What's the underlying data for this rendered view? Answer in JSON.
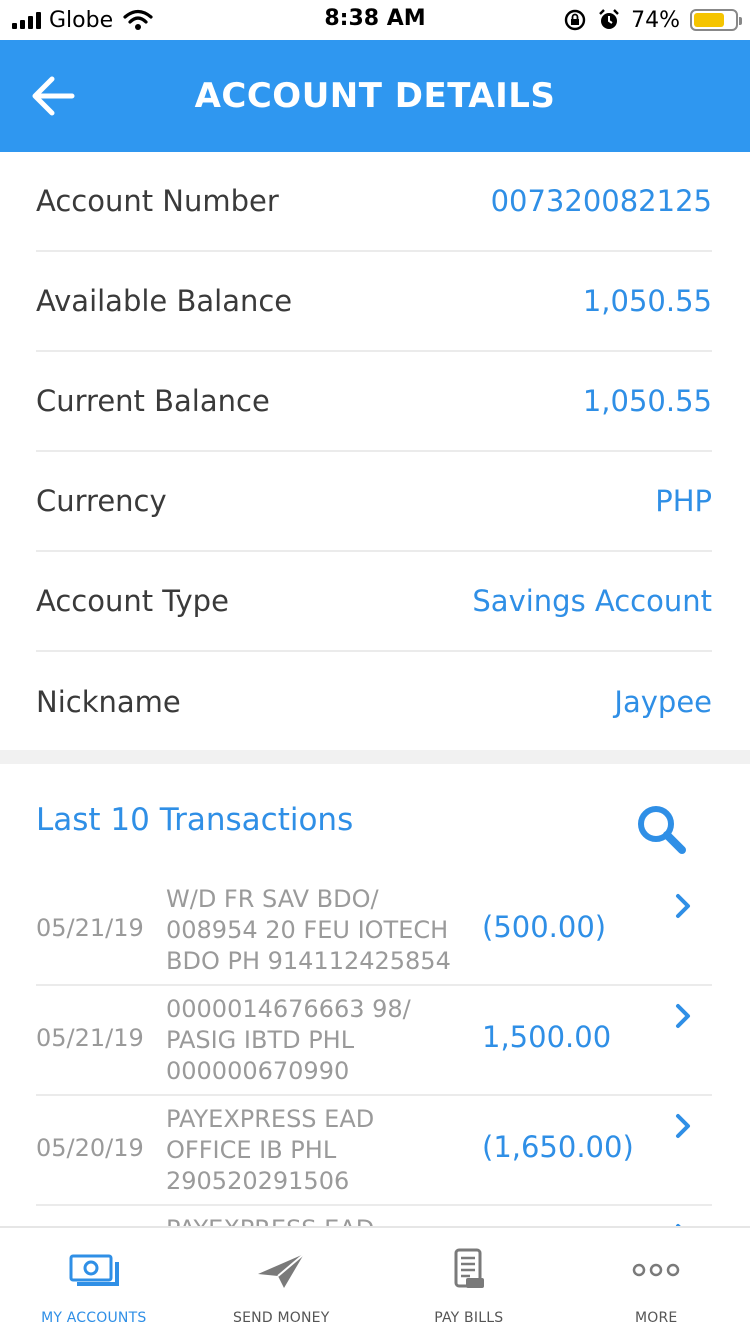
{
  "status_bar": {
    "carrier": "Globe",
    "time": "8:38 AM",
    "battery": "74%",
    "battery_level": 0.74
  },
  "header": {
    "title": "ACCOUNT DETAILS",
    "back_icon": "arrow-left-icon"
  },
  "details": [
    {
      "label": "Account Number",
      "value": "007320082125"
    },
    {
      "label": "Available Balance",
      "value": "1,050.55"
    },
    {
      "label": "Current Balance",
      "value": "1,050.55"
    },
    {
      "label": "Currency",
      "value": "PHP"
    },
    {
      "label": "Account Type",
      "value": "Savings Account"
    },
    {
      "label": "Nickname",
      "value": "Jaypee"
    }
  ],
  "transactions_section": {
    "title": "Last 10 Transactions",
    "search_icon": "search-icon"
  },
  "transactions": [
    {
      "date": "05/21/19",
      "description": "W/D FR SAV BDO/\n008954 20 FEU IOTECH\nBDO PH  914112425854",
      "amount": "(500.00)"
    },
    {
      "date": "05/21/19",
      "description": "0000014676663 98/\nPASIG IBTD PHL\n000000670990",
      "amount": "1,500.00"
    },
    {
      "date": "05/20/19",
      "description": "PAYEXPRESS EAD\nOFFICE IB PHL\n290520291506",
      "amount": "(1,650.00)"
    },
    {
      "date": "",
      "description": "PAYEXPRESS EAD",
      "amount": ""
    }
  ],
  "tab_bar": {
    "tabs": [
      {
        "label": "MY ACCOUNTS",
        "icon": "money-icon",
        "active": true
      },
      {
        "label": "SEND MONEY",
        "icon": "paper-plane-icon",
        "active": false
      },
      {
        "label": "PAY BILLS",
        "icon": "bill-icon",
        "active": false
      },
      {
        "label": "MORE",
        "icon": "more-icon",
        "active": false
      }
    ]
  },
  "colors": {
    "header_bg": "#2f97f0",
    "accent": "#2f8fe6",
    "muted_text": "#9a9a9a",
    "battery": "#f5c400"
  }
}
